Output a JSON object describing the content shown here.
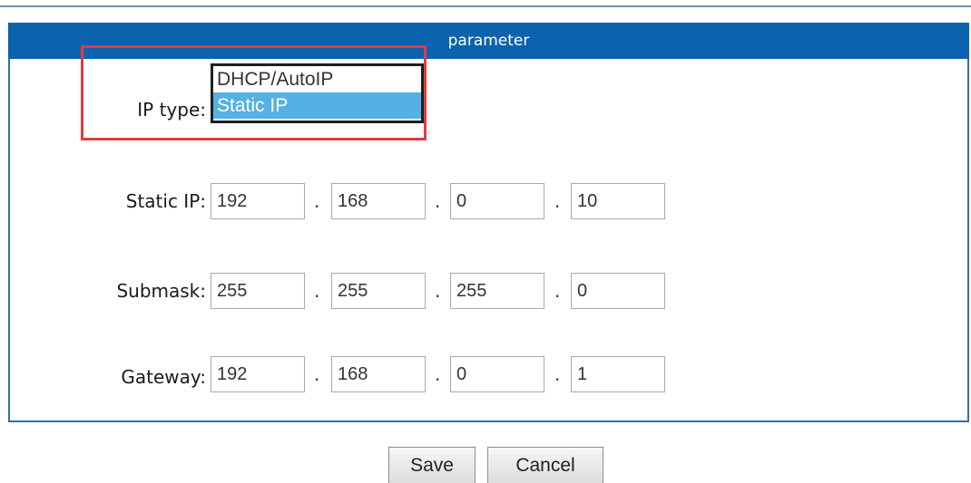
{
  "panel": {
    "title": "parameter"
  },
  "ip_type": {
    "label": "IP type:",
    "options": [
      "DHCP/AutoIP",
      "Static IP"
    ],
    "selected": "Static IP"
  },
  "static_ip": {
    "label": "Static IP:",
    "octets": [
      "192",
      "168",
      "0",
      "10"
    ]
  },
  "submask": {
    "label": "Submask:",
    "octets": [
      "255",
      "255",
      "255",
      "0"
    ]
  },
  "gateway": {
    "label": "Gateway:",
    "octets": [
      "192",
      "168",
      "0",
      "1"
    ]
  },
  "separator": ".",
  "buttons": {
    "save": "Save",
    "cancel": "Cancel"
  },
  "colors": {
    "header_bg": "#0b63ad",
    "selected_option_bg": "#55b1e4",
    "highlight_border": "#e53a3f"
  }
}
